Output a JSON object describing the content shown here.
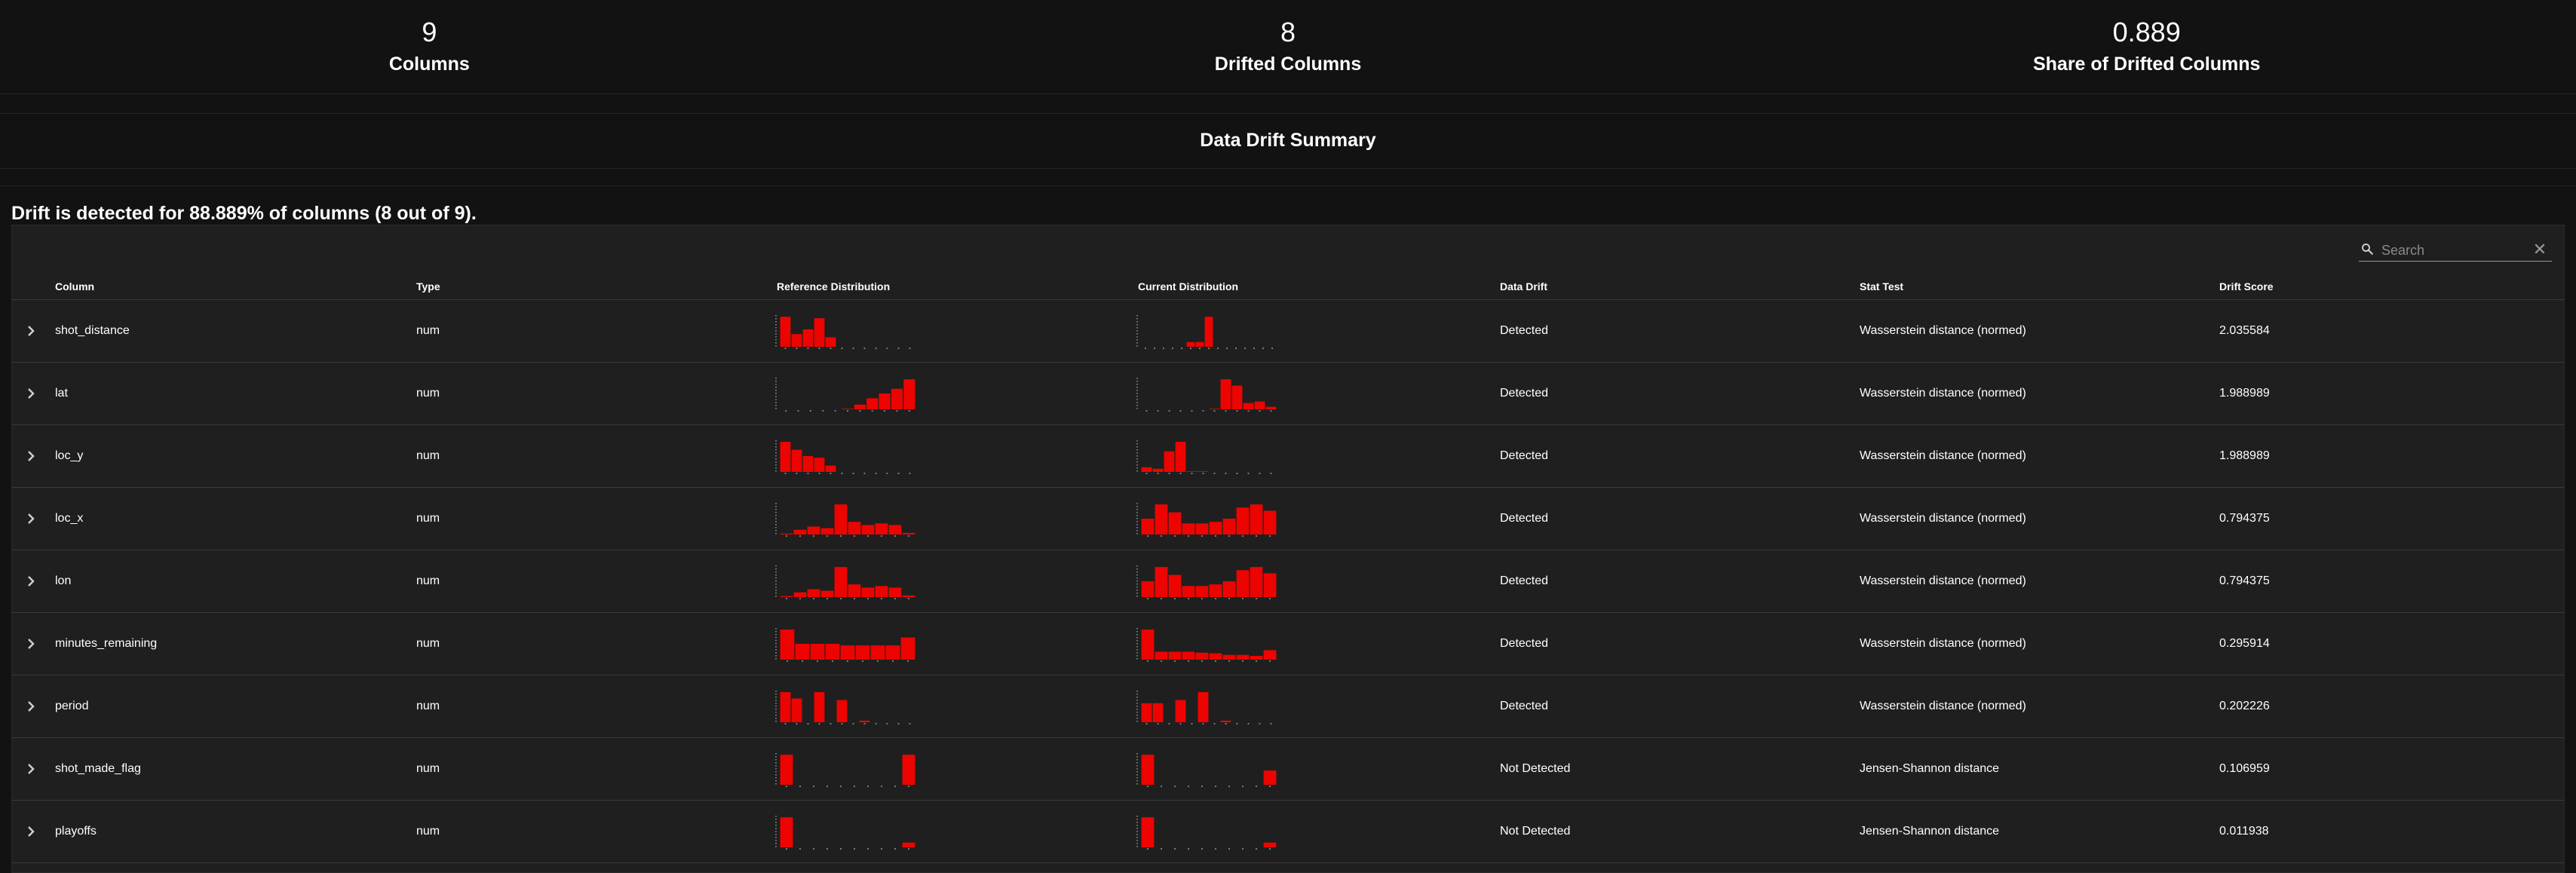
{
  "stats": [
    {
      "value": "9",
      "label": "Columns"
    },
    {
      "value": "8",
      "label": "Drifted Columns"
    },
    {
      "value": "0.889",
      "label": "Share of Drifted Columns"
    }
  ],
  "summary_title": "Data Drift Summary",
  "drift_message": "Drift is detected for 88.889% of columns (8 out of 9).",
  "search": {
    "placeholder": "Search",
    "clear_icon": "close-icon",
    "icon": "search-icon"
  },
  "table": {
    "headers": {
      "column": "Column",
      "type": "Type",
      "reference": "Reference Distribution",
      "current": "Current Distribution",
      "drift": "Data Drift",
      "stat_test": "Stat Test",
      "score": "Drift Score"
    },
    "bar_color": "#ed0400",
    "rows": [
      {
        "column": "shot_distance",
        "type": "num",
        "drift": "Detected",
        "stat_test": "Wasserstein distance (normed)",
        "score": "2.035584",
        "ref": [
          0.95,
          0.4,
          0.55,
          0.9,
          0.3,
          0,
          0,
          0,
          0,
          0,
          0,
          0
        ],
        "cur": [
          0,
          0,
          0,
          0,
          0,
          0.15,
          0.15,
          0.95,
          0,
          0,
          0,
          0,
          0,
          0,
          0
        ]
      },
      {
        "column": "lat",
        "type": "num",
        "drift": "Detected",
        "stat_test": "Wasserstein distance (normed)",
        "score": "1.988989",
        "ref": [
          0,
          0,
          0,
          0,
          0,
          0.02,
          0.15,
          0.35,
          0.5,
          0.65,
          0.95
        ],
        "cur": [
          0,
          0,
          0,
          0,
          0,
          0,
          0.02,
          0.95,
          0.75,
          0.2,
          0.25,
          0.08
        ]
      },
      {
        "column": "loc_y",
        "type": "num",
        "drift": "Detected",
        "stat_test": "Wasserstein distance (normed)",
        "score": "1.988989",
        "ref": [
          0.95,
          0.7,
          0.5,
          0.45,
          0.2,
          0,
          0,
          0,
          0,
          0,
          0,
          0
        ],
        "cur": [
          0.15,
          0.1,
          0.65,
          0.95,
          0.02,
          0.02,
          0,
          0,
          0,
          0,
          0,
          0
        ]
      },
      {
        "column": "loc_x",
        "type": "num",
        "drift": "Detected",
        "stat_test": "Wasserstein distance (normed)",
        "score": "0.794375",
        "ref": [
          0.03,
          0.15,
          0.25,
          0.2,
          0.95,
          0.4,
          0.3,
          0.35,
          0.3,
          0.05
        ],
        "cur": [
          0.5,
          0.95,
          0.7,
          0.35,
          0.35,
          0.4,
          0.5,
          0.85,
          0.95,
          0.75
        ]
      },
      {
        "column": "lon",
        "type": "num",
        "drift": "Detected",
        "stat_test": "Wasserstein distance (normed)",
        "score": "0.794375",
        "ref": [
          0.03,
          0.15,
          0.25,
          0.2,
          0.95,
          0.4,
          0.3,
          0.35,
          0.3,
          0.05
        ],
        "cur": [
          0.5,
          0.95,
          0.7,
          0.35,
          0.35,
          0.4,
          0.5,
          0.85,
          0.95,
          0.75
        ]
      },
      {
        "column": "minutes_remaining",
        "type": "num",
        "drift": "Detected",
        "stat_test": "Wasserstein distance (normed)",
        "score": "0.295914",
        "ref": [
          0.95,
          0.5,
          0.5,
          0.5,
          0.45,
          0.45,
          0.45,
          0.45,
          0.7
        ],
        "cur": [
          0.95,
          0.25,
          0.25,
          0.25,
          0.22,
          0.2,
          0.15,
          0.15,
          0.12,
          0.3
        ]
      },
      {
        "column": "period",
        "type": "num",
        "drift": "Detected",
        "stat_test": "Wasserstein distance (normed)",
        "score": "0.202226",
        "ref": [
          0.95,
          0.75,
          0,
          0.95,
          0,
          0.7,
          0,
          0.05,
          0,
          0,
          0,
          0
        ],
        "cur": [
          0.6,
          0.6,
          0,
          0.7,
          0,
          0.95,
          0,
          0.05,
          0,
          0,
          0,
          0
        ]
      },
      {
        "column": "shot_made_flag",
        "type": "num",
        "drift": "Not Detected",
        "stat_test": "Jensen-Shannon distance",
        "score": "0.106959",
        "ref": [
          0.95,
          0,
          0,
          0,
          0,
          0,
          0,
          0,
          0,
          0.95
        ],
        "cur": [
          0.95,
          0,
          0,
          0,
          0,
          0,
          0,
          0,
          0,
          0.45
        ]
      },
      {
        "column": "playoffs",
        "type": "num",
        "drift": "Not Detected",
        "stat_test": "Jensen-Shannon distance",
        "score": "0.011938",
        "ref": [
          0.95,
          0,
          0,
          0,
          0,
          0,
          0,
          0,
          0,
          0.15
        ],
        "cur": [
          0.95,
          0,
          0,
          0,
          0,
          0,
          0,
          0,
          0,
          0.15
        ]
      }
    ]
  }
}
